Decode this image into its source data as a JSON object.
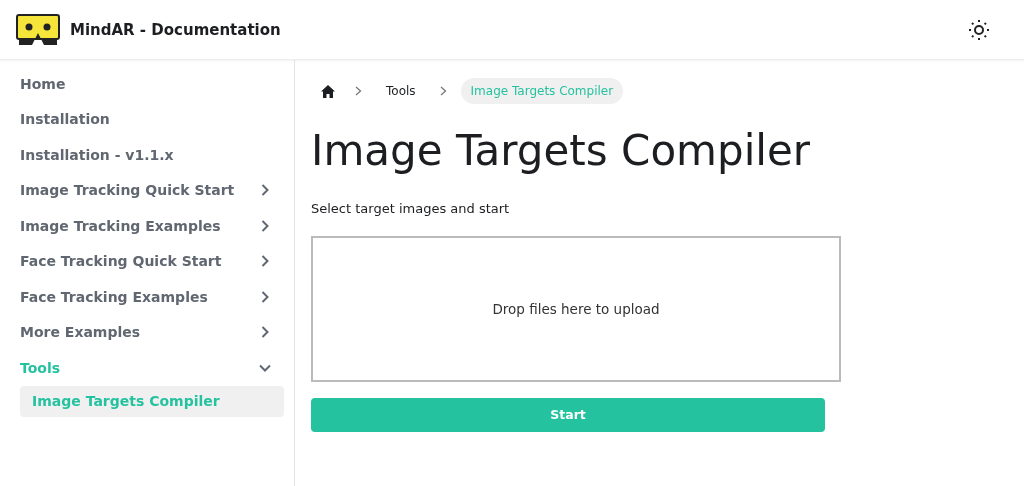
{
  "navbar": {
    "title": "MindAR - Documentation"
  },
  "sidebar": {
    "items": [
      {
        "label": "Home",
        "selected": false
      },
      {
        "label": "Installation",
        "selected": false
      },
      {
        "label": "Installation - v1.1.x",
        "selected": false
      },
      {
        "label": "Image Tracking Quick Start",
        "expanded": false,
        "selected": false
      },
      {
        "label": "Image Tracking Examples",
        "expanded": false,
        "selected": false
      },
      {
        "label": "Face Tracking Quick Start",
        "expanded": false,
        "selected": false
      },
      {
        "label": "Face Tracking Examples",
        "expanded": false,
        "selected": false
      },
      {
        "label": "More Examples",
        "expanded": false,
        "selected": false
      },
      {
        "label": "Tools",
        "expanded": true,
        "selected": true,
        "children": [
          {
            "label": "Image Targets Compiler",
            "selected": true
          }
        ]
      }
    ]
  },
  "breadcrumbs": [
    {
      "label": "Tools",
      "selected": false
    },
    {
      "label": "Image Targets Compiler",
      "selected": true
    }
  ],
  "page": {
    "title": "Image Targets Compiler",
    "instructions": "Select target images and start",
    "dropzone": "Drop files here to upload",
    "button": "Start"
  }
}
